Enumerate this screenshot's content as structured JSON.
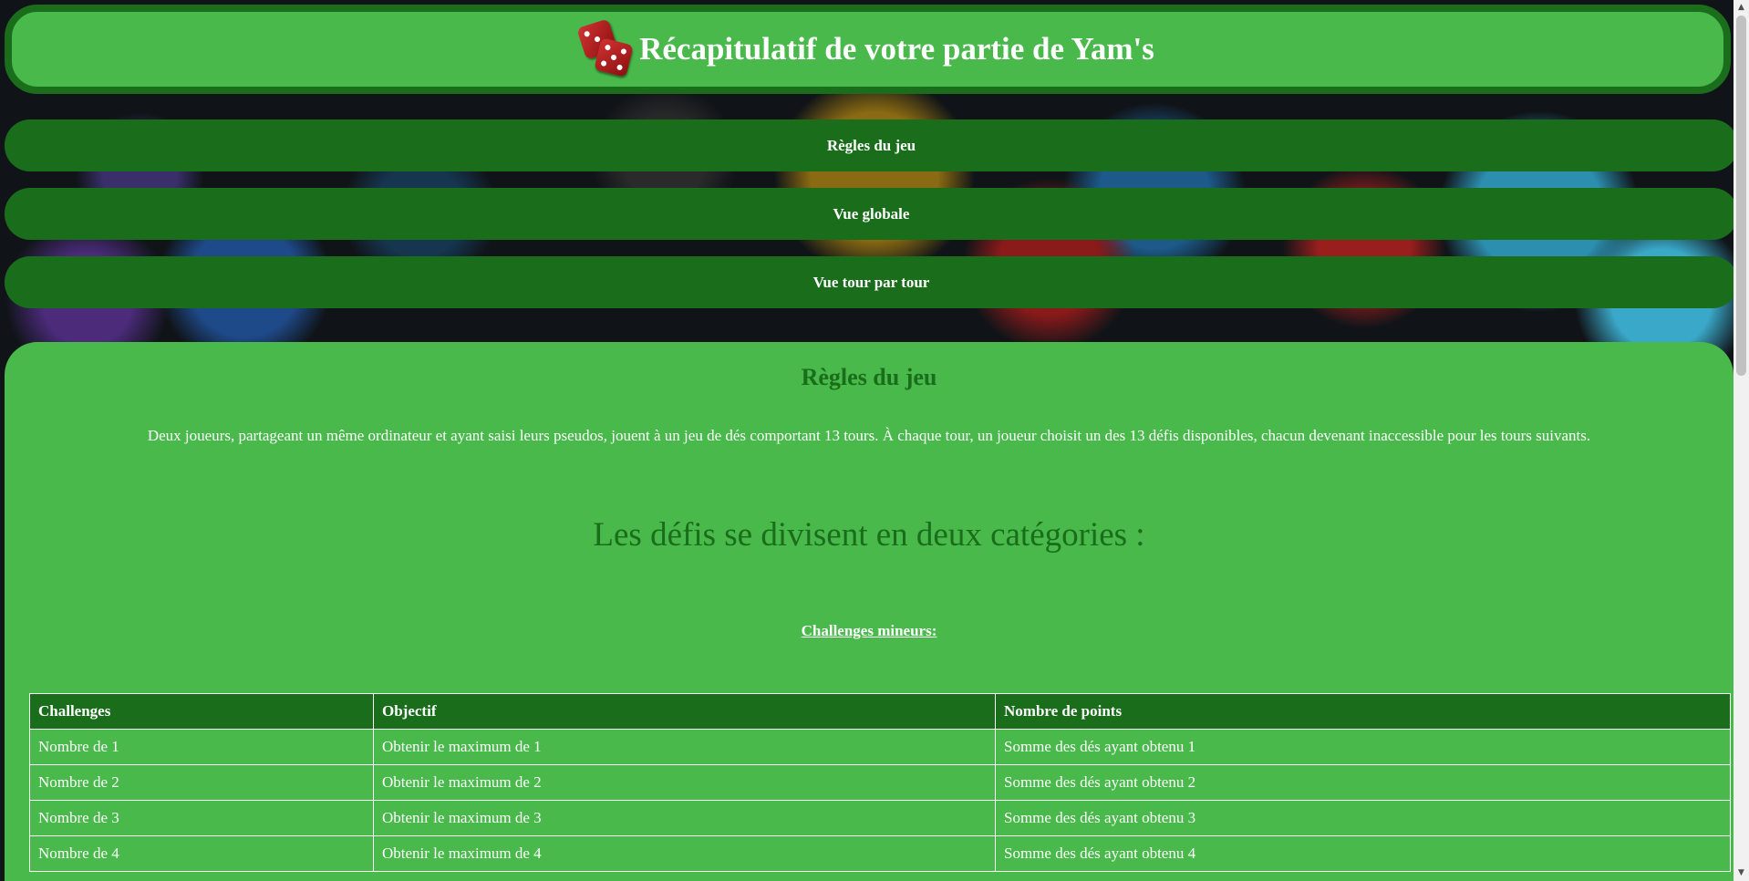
{
  "header": {
    "title": "Récapitulatif de votre partie de Yam's",
    "icon": "dice-icon"
  },
  "nav": {
    "rules": "Règles du jeu",
    "global_view": "Vue globale",
    "turn_view": "Vue tour par tour"
  },
  "rules_section": {
    "title": "Règles du jeu",
    "intro": "Deux joueurs, partageant un même ordinateur et ayant saisi leurs pseudos, jouent à un jeu de dés comportant 13 tours. À chaque tour, un joueur choisit un des 13 défis disponibles, chacun devenant inaccessible pour les tours suivants.",
    "categories_heading": "Les défis se divisent en deux catégories :",
    "minor_heading": "Challenges mineurs:",
    "table": {
      "headers": [
        "Challenges",
        "Objectif",
        "Nombre de points"
      ],
      "rows": [
        [
          "Nombre de 1",
          "Obtenir le maximum de 1",
          "Somme des dés ayant obtenu 1"
        ],
        [
          "Nombre de 2",
          "Obtenir le maximum de 2",
          "Somme des dés ayant obtenu 2"
        ],
        [
          "Nombre de 3",
          "Obtenir le maximum de 3",
          "Somme des dés ayant obtenu 3"
        ],
        [
          "Nombre de 4",
          "Obtenir le maximum de 4",
          "Somme des dés ayant obtenu 4"
        ]
      ]
    }
  },
  "colors": {
    "panel_green": "#48b94a",
    "dark_green": "#1a6e1b",
    "text_white": "#ffffff"
  }
}
